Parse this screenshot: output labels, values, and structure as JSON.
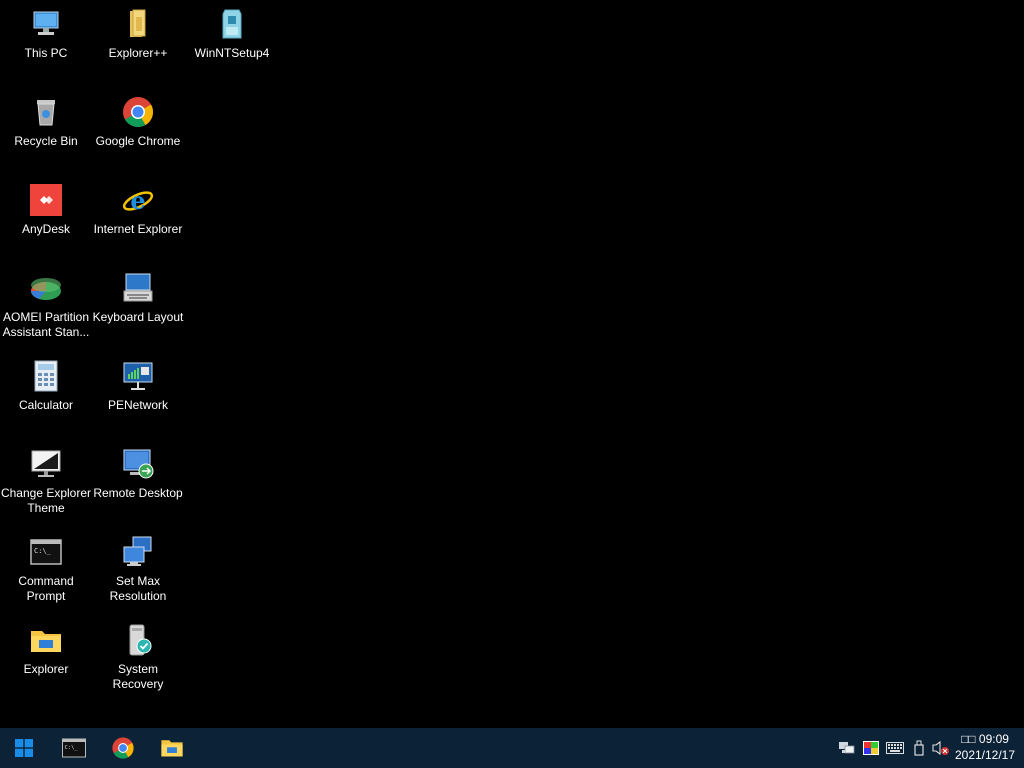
{
  "desktop": {
    "icons": [
      {
        "label": "This PC",
        "icon": "this-pc-icon"
      },
      {
        "label": "Explorer++",
        "icon": "explorer-plus-plus-icon"
      },
      {
        "label": "WinNTSetup4",
        "icon": "winntsetup-icon"
      },
      {
        "label": "Recycle Bin",
        "icon": "recycle-bin-icon"
      },
      {
        "label": "Google Chrome",
        "icon": "chrome-icon"
      },
      {
        "label": "AnyDesk",
        "icon": "anydesk-icon"
      },
      {
        "label": "Internet Explorer",
        "icon": "internet-explorer-icon"
      },
      {
        "label": "AOMEI Partition Assistant Stan...",
        "icon": "aomei-partition-icon"
      },
      {
        "label": "Keyboard Layout",
        "icon": "keyboard-layout-icon"
      },
      {
        "label": "Calculator",
        "icon": "calculator-icon"
      },
      {
        "label": "PENetwork",
        "icon": "penetwork-icon"
      },
      {
        "label": "Change Explorer Theme",
        "icon": "change-theme-icon"
      },
      {
        "label": "Remote Desktop",
        "icon": "remote-desktop-icon"
      },
      {
        "label": "Command Prompt",
        "icon": "command-prompt-icon"
      },
      {
        "label": "Set Max Resolution",
        "icon": "set-max-resolution-icon"
      },
      {
        "label": "Explorer",
        "icon": "explorer-icon"
      },
      {
        "label": "System Recovery",
        "icon": "system-recovery-icon"
      }
    ]
  },
  "taskbar": {
    "start_icon": "windows-start-icon",
    "pinned": [
      {
        "icon": "command-prompt-icon"
      },
      {
        "icon": "chrome-icon"
      },
      {
        "icon": "file-explorer-icon"
      }
    ],
    "tray": [
      {
        "icon": "network-icon"
      },
      {
        "icon": "color-theme-icon"
      },
      {
        "icon": "keyboard-icon"
      },
      {
        "icon": "usb-device-icon"
      },
      {
        "icon": "volume-muted-icon"
      }
    ],
    "clock": {
      "time": "□□ 09:09",
      "date": "2021/12/17"
    },
    "colors": {
      "background": "#0c2236",
      "start_blue": "#1a8ce8"
    }
  }
}
